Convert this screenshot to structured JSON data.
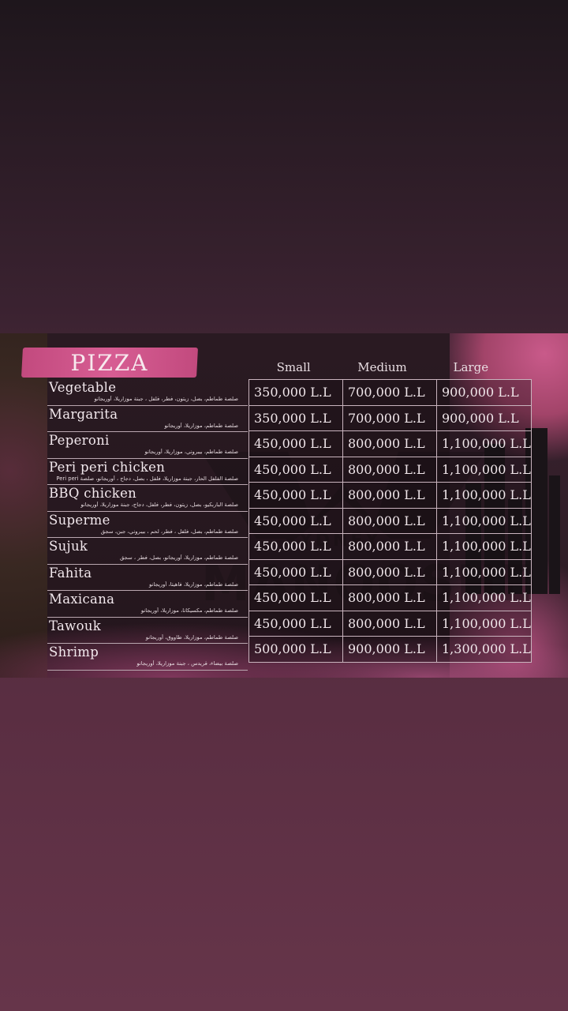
{
  "menu": {
    "title": "PIZZA",
    "watermark": {
      "line1": "SYDNEY",
      "line2": "MANOOSHE"
    },
    "columns": [
      "Small",
      "Medium",
      "Large"
    ],
    "items": [
      {
        "name": "Vegetable",
        "desc": "صلصة طماطم، بصل، زيتون، فطر، فلفل ، جبنة موزاريلا، أوريجانو",
        "prices": [
          "350,000 L.L",
          "700,000 L.L",
          "900,000 L.L"
        ]
      },
      {
        "name": "Margarita",
        "desc": "صلصة طماطم، موزاريلا، أوريجانو",
        "prices": [
          "350,000 L.L",
          "700,000 L.L",
          "900,000 L.L"
        ]
      },
      {
        "name": "Peperoni",
        "desc": "صلصة طماطم، بيبروني، موزاريلا، أوريجانو",
        "prices": [
          "450,000 L.L",
          "800,000 L.L",
          "1,100,000 L.L"
        ]
      },
      {
        "name": "Peri peri chicken",
        "desc": "صلصة الفلفل الحار، جبنة موزاريلا، فلفل ، بصل، دجاج ، أوريجانو، صلصة Peri peri",
        "prices": [
          "450,000 L.L",
          "800,000 L.L",
          "1,100,000 L.L"
        ]
      },
      {
        "name": "BBQ chicken",
        "desc": "صلصة الباربكيو، بصل، زيتون، فطر، فلفل، دجاج، جبنة موزاريلا، أوريجانو",
        "prices": [
          "450,000 L.L",
          "800,000 L.L",
          "1,100,000 L.L"
        ]
      },
      {
        "name": "Superme",
        "desc": "صلصة طماطم، بصل، فلفل ، فطر، لحم ، بيبروني، جبن، سجق",
        "prices": [
          "450,000 L.L",
          "800,000 L.L",
          "1,100,000 L.L"
        ]
      },
      {
        "name": "Sujuk",
        "desc": "صلصة طماطم، موزاريلا، أوريجانو، بصل، فطر ، سجق",
        "prices": [
          "450,000 L.L",
          "800,000 L.L",
          "1,100,000 L.L"
        ]
      },
      {
        "name": "Fahita",
        "desc": "صلصة طماطم، موزاريلا، فاهيتا، أوريجانو",
        "prices": [
          "450,000 L.L",
          "800,000 L.L",
          "1,100,000 L.L"
        ]
      },
      {
        "name": "Maxicana",
        "desc": "صلصة طماطم، مكسيكانا، موزاريلا، أوريجانو",
        "prices": [
          "450,000 L.L",
          "800,000 L.L",
          "1,100,000 L.L"
        ]
      },
      {
        "name": "Tawouk",
        "desc": "صلصة طماطم، موزاريلا، طاووق، أوريجانو",
        "prices": [
          "450,000 L.L",
          "800,000 L.L",
          "1,100,000 L.L"
        ]
      },
      {
        "name": "Shrimp",
        "desc": "صلصة بيضاء، قريدس ، جبنة موزاريلا، أوريجانو",
        "prices": [
          "500,000 L.L",
          "900,000 L.L",
          "1,300,000 L.L"
        ]
      }
    ]
  }
}
